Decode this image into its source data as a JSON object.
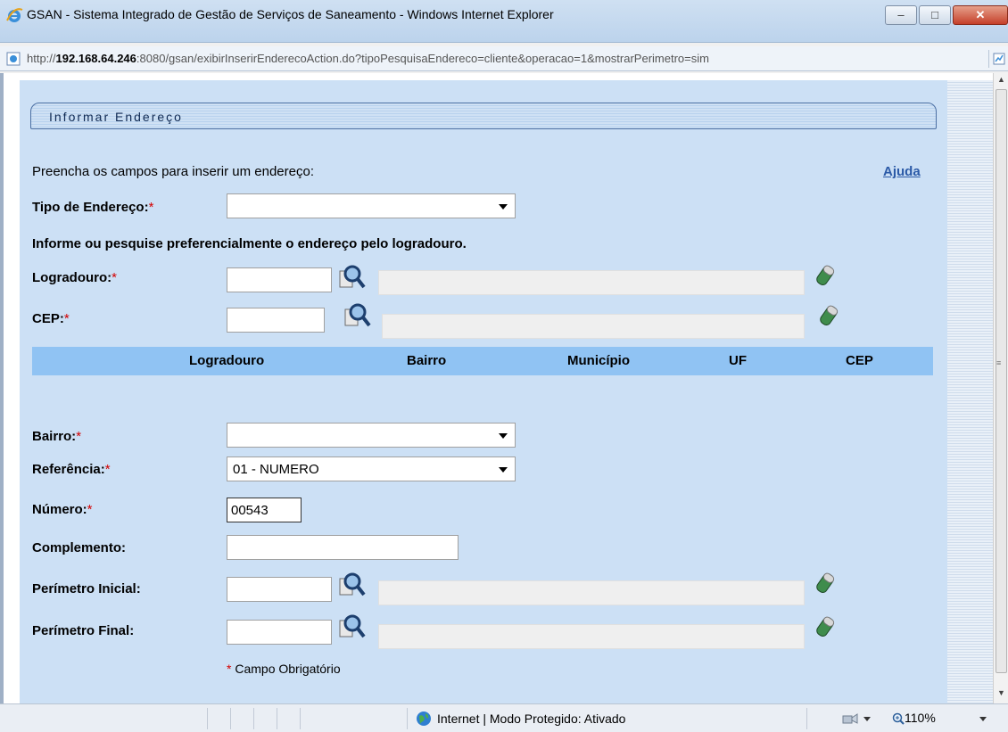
{
  "window": {
    "title": "GSAN - Sistema Integrado de Gestão de Serviços de Saneamento - Windows Internet Explorer",
    "minimize_glyph": "–",
    "maximize_glyph": "□",
    "close_glyph": "✕"
  },
  "address": {
    "prefix": "http://",
    "host": "192.168.64.246",
    "rest": ":8080/gsan/exibirInserirEnderecoAction.do?tipoPesquisaEndereco=cliente&operacao=1&mostrarPerimetro=sim"
  },
  "form": {
    "header": "Informar Endereço",
    "instruction": "Preencha os campos para inserir um endereço:",
    "help_link": "Ajuda",
    "required_mark": "*",
    "tipo_endereco": {
      "label": "Tipo de Endereço:",
      "value": ""
    },
    "hint": "Informe ou pesquise preferencialmente o endereço pelo logradouro.",
    "logradouro": {
      "label": "Logradouro:",
      "value": ""
    },
    "cep": {
      "label": "CEP:",
      "value": ""
    },
    "table_headers": [
      "Logradouro",
      "Bairro",
      "Município",
      "UF",
      "CEP"
    ],
    "bairro": {
      "label": "Bairro:",
      "value": ""
    },
    "referencia": {
      "label": "Referência:",
      "value": "01 - NUMERO"
    },
    "numero": {
      "label": "Número:",
      "value": "00543"
    },
    "complemento": {
      "label": "Complemento:",
      "value": ""
    },
    "perimetro_inicial": {
      "label": "Perímetro Inicial:",
      "value": ""
    },
    "perimetro_final": {
      "label": "Perímetro Final:",
      "value": ""
    },
    "required_note": "Campo Obrigatório"
  },
  "statusbar": {
    "zone": "Internet | Modo Protegido: Ativado",
    "zoom": "110%"
  },
  "icons": [
    "ie-logo-icon",
    "page-icon",
    "rss-icon",
    "search-icon",
    "eraser-icon",
    "globe-icon",
    "zoom-icon"
  ],
  "colors": {
    "form_bg": "#cce0f5",
    "table_header_bg": "#90c3f3",
    "link": "#2b5aa7",
    "required": "#d40000"
  }
}
